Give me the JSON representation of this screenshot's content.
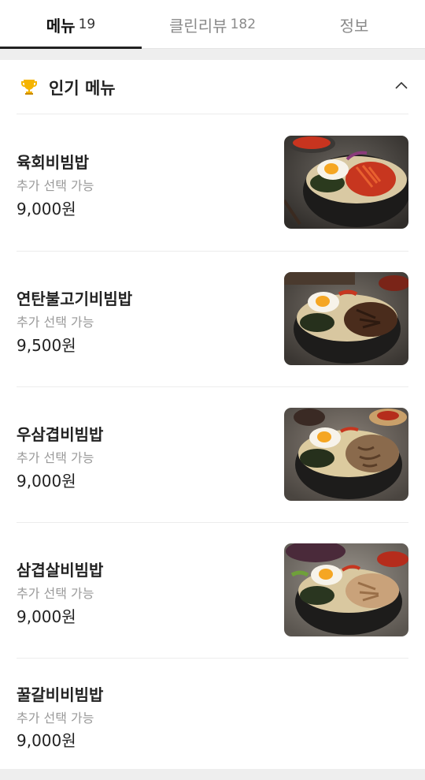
{
  "tabs": [
    {
      "label": "메뉴",
      "count": "19",
      "active": true
    },
    {
      "label": "클린리뷰",
      "count": "182",
      "active": false
    },
    {
      "label": "정보",
      "count": "",
      "active": false
    }
  ],
  "section": {
    "title": "인기 메뉴",
    "icon": "trophy-icon",
    "toggle_icon": "chevron-up-icon"
  },
  "items": [
    {
      "name": "육회비빔밥",
      "option": "추가 선택 가능",
      "price": "9,000원",
      "has_image": true
    },
    {
      "name": "연탄불고기비빔밥",
      "option": "추가 선택 가능",
      "price": "9,500원",
      "has_image": true
    },
    {
      "name": "우삼겹비빔밥",
      "option": "추가 선택 가능",
      "price": "9,000원",
      "has_image": true
    },
    {
      "name": "삼겹살비빔밥",
      "option": "추가 선택 가능",
      "price": "9,000원",
      "has_image": true
    },
    {
      "name": "꿀갈비비빔밥",
      "option": "추가 선택 가능",
      "price": "9,000원",
      "has_image": false
    }
  ],
  "colors": {
    "active_text": "#111111",
    "inactive_text": "#8a8a8a",
    "indicator": "#222222",
    "trophy": "#f5b400",
    "separator": "#eeeeee"
  }
}
